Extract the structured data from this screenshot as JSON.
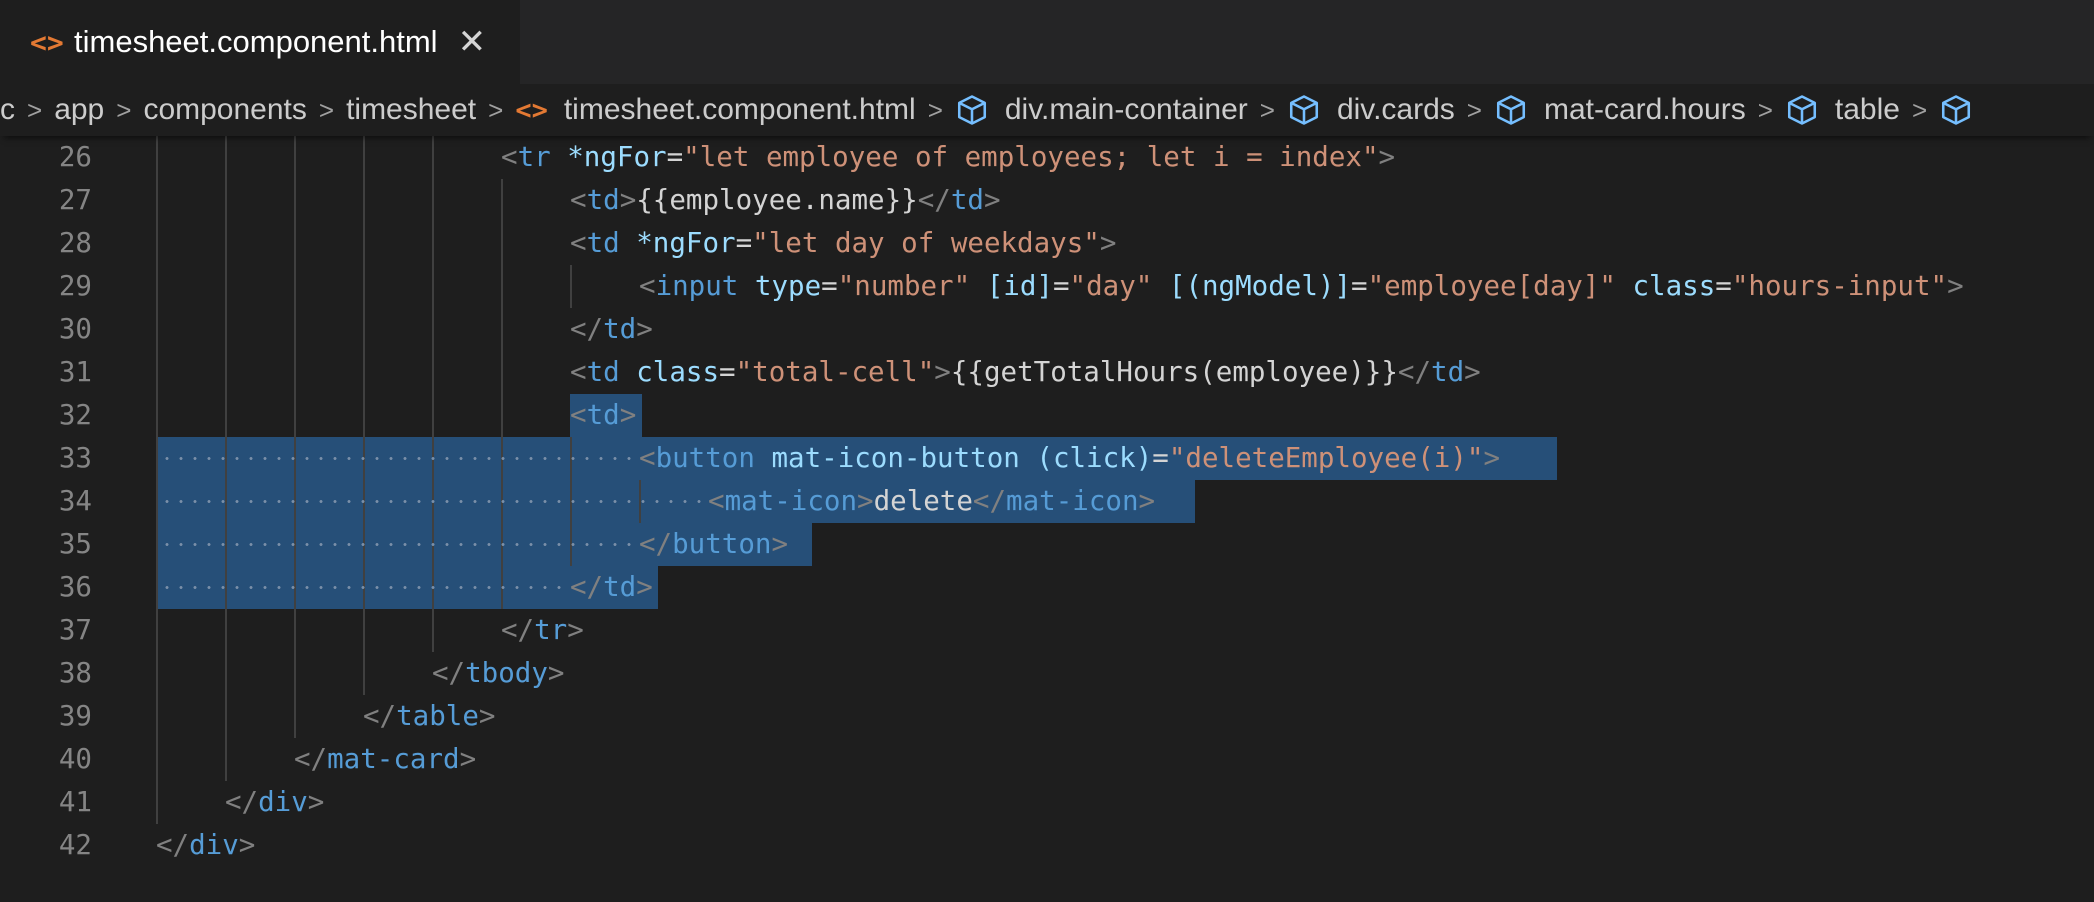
{
  "tab": {
    "title": "timesheet.component.html",
    "icon": "html-file-icon",
    "close_glyph": "✕"
  },
  "breadcrumb": {
    "items": [
      {
        "label": "c",
        "icon": ""
      },
      {
        "label": "app",
        "icon": ""
      },
      {
        "label": "components",
        "icon": ""
      },
      {
        "label": "timesheet",
        "icon": ""
      },
      {
        "label": "timesheet.component.html",
        "icon": "html-file-icon"
      },
      {
        "label": "div.main-container",
        "icon": "element-box-icon"
      },
      {
        "label": "div.cards",
        "icon": "element-box-icon"
      },
      {
        "label": "mat-card.hours",
        "icon": "element-box-icon"
      },
      {
        "label": "table",
        "icon": "element-box-icon"
      }
    ]
  },
  "colors": {
    "background": "#1e1e1e",
    "tabbar": "#252526",
    "selection": "#264f78",
    "tag": "#569cd6",
    "attribute": "#9cdcfe",
    "string": "#ce9178",
    "file_icon": "#e37933"
  },
  "editor": {
    "lines": [
      {
        "num": "26",
        "indent": 5,
        "tokens": [
          [
            "p",
            "<"
          ],
          [
            "t",
            "tr"
          ],
          [
            "tx",
            " "
          ],
          [
            "a",
            "*ngFor"
          ],
          [
            "tx",
            "="
          ],
          [
            "s",
            "\"let employee of employees; let i = index\""
          ],
          [
            "p",
            ">"
          ]
        ]
      },
      {
        "num": "27",
        "indent": 6,
        "tokens": [
          [
            "p",
            "<"
          ],
          [
            "t",
            "td"
          ],
          [
            "p",
            ">"
          ],
          [
            "tx",
            "{{employee.name}}"
          ],
          [
            "p",
            "</"
          ],
          [
            "t",
            "td"
          ],
          [
            "p",
            ">"
          ]
        ]
      },
      {
        "num": "28",
        "indent": 6,
        "tokens": [
          [
            "p",
            "<"
          ],
          [
            "t",
            "td"
          ],
          [
            "tx",
            " "
          ],
          [
            "a",
            "*ngFor"
          ],
          [
            "tx",
            "="
          ],
          [
            "s",
            "\"let day of weekdays\""
          ],
          [
            "p",
            ">"
          ]
        ]
      },
      {
        "num": "29",
        "indent": 7,
        "tokens": [
          [
            "p",
            "<"
          ],
          [
            "t",
            "input"
          ],
          [
            "tx",
            " "
          ],
          [
            "a",
            "type"
          ],
          [
            "tx",
            "="
          ],
          [
            "s",
            "\"number\""
          ],
          [
            "tx",
            " "
          ],
          [
            "a",
            "[id]"
          ],
          [
            "tx",
            "="
          ],
          [
            "s",
            "\"day\""
          ],
          [
            "tx",
            " "
          ],
          [
            "a",
            "[(ngModel)]"
          ],
          [
            "tx",
            "="
          ],
          [
            "s",
            "\"employee[day]\""
          ],
          [
            "tx",
            " "
          ],
          [
            "a",
            "class"
          ],
          [
            "tx",
            "="
          ],
          [
            "s",
            "\"hours-input\""
          ],
          [
            "p",
            ">"
          ]
        ]
      },
      {
        "num": "30",
        "indent": 6,
        "tokens": [
          [
            "p",
            "</"
          ],
          [
            "t",
            "td"
          ],
          [
            "p",
            ">"
          ]
        ]
      },
      {
        "num": "31",
        "indent": 6,
        "tokens": [
          [
            "p",
            "<"
          ],
          [
            "t",
            "td"
          ],
          [
            "tx",
            " "
          ],
          [
            "a",
            "class"
          ],
          [
            "tx",
            "="
          ],
          [
            "s",
            "\"total-cell\""
          ],
          [
            "p",
            ">"
          ],
          [
            "tx",
            "{{getTotalHours(employee)}}"
          ],
          [
            "p",
            "</"
          ],
          [
            "t",
            "td"
          ],
          [
            "p",
            ">"
          ]
        ]
      },
      {
        "num": "32",
        "indent": 6,
        "tokens": [
          [
            "p",
            "<"
          ],
          [
            "t",
            "td"
          ],
          [
            "p",
            ">"
          ]
        ]
      },
      {
        "num": "33",
        "indent": 7,
        "tokens": [
          [
            "p",
            "<"
          ],
          [
            "t",
            "button"
          ],
          [
            "tx",
            " "
          ],
          [
            "a",
            "mat-icon-button"
          ],
          [
            "tx",
            " "
          ],
          [
            "a",
            "(click)"
          ],
          [
            "tx",
            "="
          ],
          [
            "s",
            "\"deleteEmployee(i)\""
          ],
          [
            "p",
            ">"
          ]
        ]
      },
      {
        "num": "34",
        "indent": 8,
        "tokens": [
          [
            "p",
            "<"
          ],
          [
            "t",
            "mat-icon"
          ],
          [
            "p",
            ">"
          ],
          [
            "tx",
            "delete"
          ],
          [
            "p",
            "</"
          ],
          [
            "t",
            "mat-icon"
          ],
          [
            "p",
            ">"
          ]
        ]
      },
      {
        "num": "35",
        "indent": 7,
        "tokens": [
          [
            "p",
            "</"
          ],
          [
            "t",
            "button"
          ],
          [
            "p",
            ">"
          ]
        ]
      },
      {
        "num": "36",
        "indent": 6,
        "tokens": [
          [
            "p",
            "</"
          ],
          [
            "t",
            "td"
          ],
          [
            "p",
            ">"
          ]
        ]
      },
      {
        "num": "37",
        "indent": 5,
        "tokens": [
          [
            "p",
            "</"
          ],
          [
            "t",
            "tr"
          ],
          [
            "p",
            ">"
          ]
        ]
      },
      {
        "num": "38",
        "indent": 4,
        "tokens": [
          [
            "p",
            "</"
          ],
          [
            "t",
            "tbody"
          ],
          [
            "p",
            ">"
          ]
        ]
      },
      {
        "num": "39",
        "indent": 3,
        "tokens": [
          [
            "p",
            "</"
          ],
          [
            "t",
            "table"
          ],
          [
            "p",
            ">"
          ]
        ]
      },
      {
        "num": "40",
        "indent": 2,
        "tokens": [
          [
            "p",
            "</"
          ],
          [
            "t",
            "mat-card"
          ],
          [
            "p",
            ">"
          ]
        ]
      },
      {
        "num": "41",
        "indent": 1,
        "tokens": [
          [
            "p",
            "</"
          ],
          [
            "t",
            "div"
          ],
          [
            "p",
            ">"
          ]
        ]
      },
      {
        "num": "42",
        "indent": 0,
        "tokens": [
          [
            "p",
            "</"
          ],
          [
            "t",
            "div"
          ],
          [
            "p",
            ">"
          ]
        ]
      }
    ]
  }
}
